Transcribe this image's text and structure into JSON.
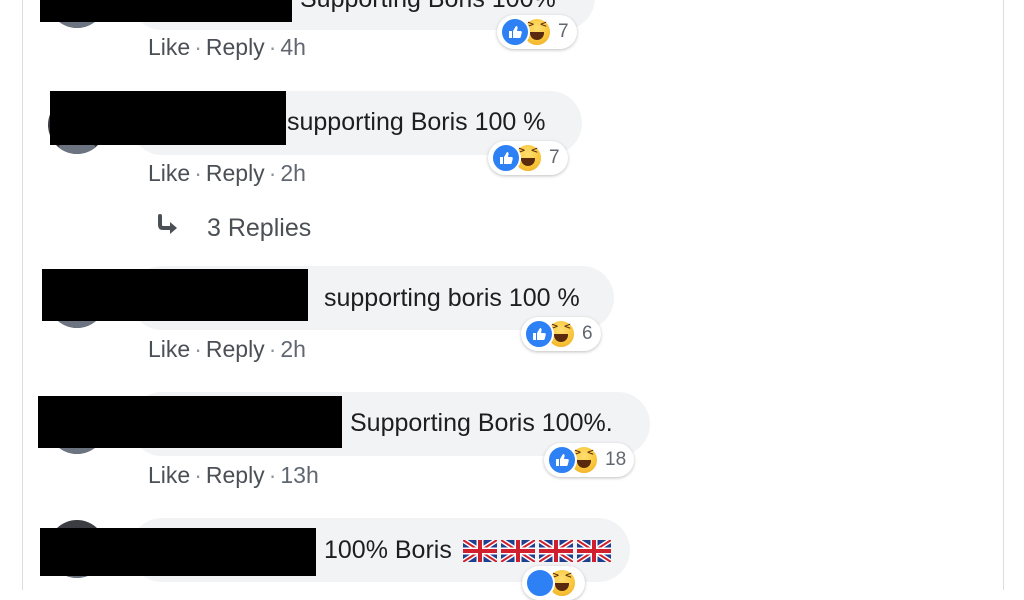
{
  "comments": [
    {
      "text": "Supporting Boris 100%",
      "like": "Like",
      "reply": "Reply",
      "time": "4h",
      "reaction_count": "7"
    },
    {
      "text": "supporting Boris 100 %",
      "like": "Like",
      "reply": "Reply",
      "time": "2h",
      "reaction_count": "7"
    },
    {
      "text": "supporting boris 100 %",
      "like": "Like",
      "reply": "Reply",
      "time": "2h",
      "reaction_count": "6"
    },
    {
      "text": "Supporting Boris 100%.",
      "like": "Like",
      "reply": "Reply",
      "time": "13h",
      "reaction_count": "18"
    },
    {
      "text": "100% Boris",
      "flags": 4
    }
  ],
  "replies_link": {
    "label": "3 Replies",
    "icon": "reply-arrow-icon"
  },
  "reaction_icons": [
    "like-icon",
    "haha-icon"
  ],
  "colors": {
    "bubble": "#f2f3f5",
    "like_blue": "#2e81f4",
    "meta": "#606770",
    "redaction": "#000000"
  }
}
